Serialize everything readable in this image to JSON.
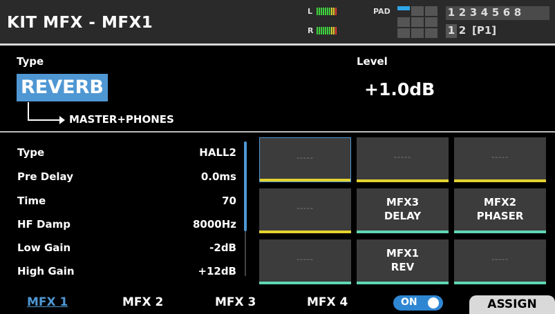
{
  "header": {
    "title": "KIT MFX - MFX1",
    "meter_l": "L",
    "meter_r": "R",
    "pad_label": "PAD",
    "numbers": [
      "1",
      "2",
      "3",
      "4",
      "5",
      "6",
      "8"
    ],
    "page_numbers": [
      "1",
      "2"
    ],
    "page_tag": "[P1]"
  },
  "main": {
    "type_label": "Type",
    "type_value": "REVERB",
    "route_label": "MASTER+PHONES",
    "level_label": "Level",
    "level_value": "+1.0dB"
  },
  "params": [
    {
      "name": "Type",
      "value": "HALL2"
    },
    {
      "name": "Pre Delay",
      "value": "0.0ms"
    },
    {
      "name": "Time",
      "value": "70"
    },
    {
      "name": "HF Damp",
      "value": "8000Hz"
    },
    {
      "name": "Low Gain",
      "value": "-2dB"
    },
    {
      "name": "High Gain",
      "value": "+12dB"
    }
  ],
  "grid": {
    "empty": "-----",
    "cells": [
      {
        "line1": "",
        "line2": "",
        "bar": "#e5d330"
      },
      {
        "line1": "",
        "line2": "",
        "bar": "#e5d330"
      },
      {
        "line1": "",
        "line2": "",
        "bar": "#e5d330"
      },
      {
        "line1": "",
        "line2": "",
        "bar": "#e5d330"
      },
      {
        "line1": "MFX3",
        "line2": "DELAY",
        "bar": "#5fd6b4"
      },
      {
        "line1": "MFX2",
        "line2": "PHASER",
        "bar": "#5fd6b4"
      },
      {
        "line1": "",
        "line2": "",
        "bar": "#5fd6b4"
      },
      {
        "line1": "MFX1",
        "line2": "REV",
        "bar": "#5fd6b4"
      },
      {
        "line1": "",
        "line2": "",
        "bar": "#5fd6b4"
      }
    ]
  },
  "tabs": {
    "mfx1": "MFX 1",
    "mfx2": "MFX 2",
    "mfx3": "MFX 3",
    "mfx4": "MFX 4",
    "on": "ON",
    "assign": "ASSIGN"
  },
  "colors": {
    "accent": "#4f97d3",
    "meter_green": "#3fd13f",
    "bar_yellow": "#e5d330",
    "bar_teal": "#5fd6b4"
  }
}
